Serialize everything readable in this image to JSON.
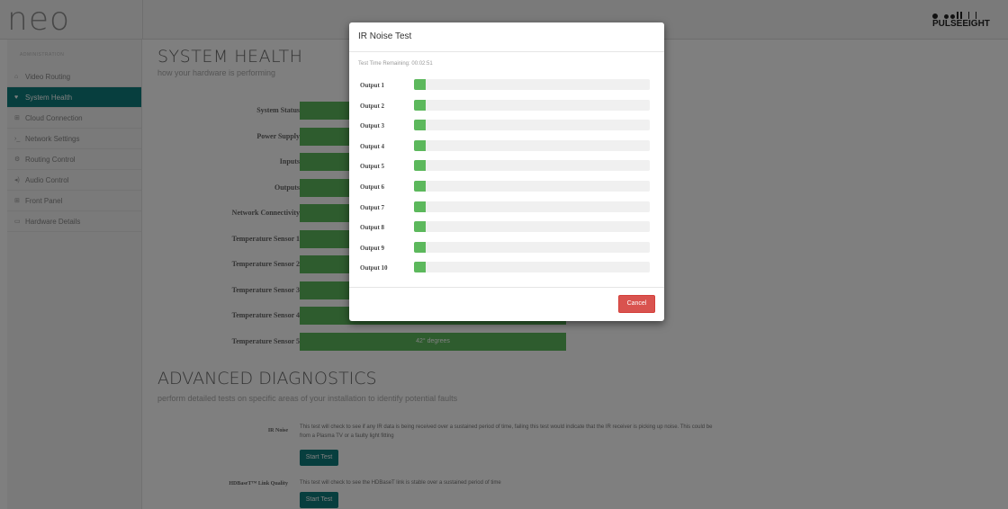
{
  "app": {
    "logo": "neo",
    "brand": "PULSEEIGHT"
  },
  "sidebar": {
    "section": "ADMINISTRATION",
    "items": [
      {
        "label": "Video Routing",
        "icon": "home-icon",
        "glyph": "⌂",
        "active": false
      },
      {
        "label": "System Health",
        "icon": "heart-icon",
        "glyph": "♥",
        "active": true
      },
      {
        "label": "Cloud Connection",
        "icon": "signal-icon",
        "glyph": "⊞",
        "active": false
      },
      {
        "label": "Network Settings",
        "icon": "terminal-icon",
        "glyph": "›_",
        "active": false
      },
      {
        "label": "Routing Control",
        "icon": "cogs-icon",
        "glyph": "⚙",
        "active": false
      },
      {
        "label": "Audio Control",
        "icon": "volume-icon",
        "glyph": "◂)",
        "active": false
      },
      {
        "label": "Front Panel",
        "icon": "grid-icon",
        "glyph": "⊞",
        "active": false
      },
      {
        "label": "Hardware Details",
        "icon": "hdd-icon",
        "glyph": "▭",
        "active": false
      }
    ]
  },
  "system_health": {
    "title": "SYSTEM HEALTH",
    "subtitle": "how your hardware is performing",
    "rows": [
      {
        "label": "System Status",
        "value": ""
      },
      {
        "label": "Power Supply",
        "value": ""
      },
      {
        "label": "Inputs",
        "value": ""
      },
      {
        "label": "Outputs",
        "value": ""
      },
      {
        "label": "Network Connectivity",
        "value": ""
      },
      {
        "label": "Temperature Sensor 1",
        "value": ""
      },
      {
        "label": "Temperature Sensor 2",
        "value": ""
      },
      {
        "label": "Temperature Sensor 3",
        "value": ""
      },
      {
        "label": "Temperature Sensor 4",
        "value": ""
      },
      {
        "label": "Temperature Sensor 5",
        "value": "42° degrees"
      }
    ]
  },
  "advanced": {
    "title": "ADVANCED DIAGNOSTICS",
    "subtitle": "perform detailed tests on specific areas of your installation to identify potential faults",
    "tests": [
      {
        "label": "IR Noise",
        "description": "This test will check to see if any IR data is being received over a sustained period of time, failing this test would indicate that the IR receiver is picking up noise. This could be from a Plasma TV or a faulty light fitting",
        "button": "Start Test"
      },
      {
        "label": "HDBaseT™ Link Quality",
        "description": "This test will check to see the HDBaseT link is stable over a sustained period of time",
        "button": "Start Test"
      }
    ]
  },
  "modal": {
    "title": "IR Noise Test",
    "timer": "Test Time Remaining: 00:02:51",
    "outputs": [
      {
        "label": "Output 1",
        "progress": 0.05
      },
      {
        "label": "Output 2",
        "progress": 0.05
      },
      {
        "label": "Output 3",
        "progress": 0.05
      },
      {
        "label": "Output 4",
        "progress": 0.05
      },
      {
        "label": "Output 5",
        "progress": 0.05
      },
      {
        "label": "Output 6",
        "progress": 0.05
      },
      {
        "label": "Output 7",
        "progress": 0.05
      },
      {
        "label": "Output 8",
        "progress": 0.05
      },
      {
        "label": "Output 9",
        "progress": 0.05
      },
      {
        "label": "Output 10",
        "progress": 0.05
      }
    ],
    "cancel": "Cancel"
  },
  "colors": {
    "teal": "#0f7c7c",
    "green": "#5cb85c",
    "red": "#d9534f"
  }
}
